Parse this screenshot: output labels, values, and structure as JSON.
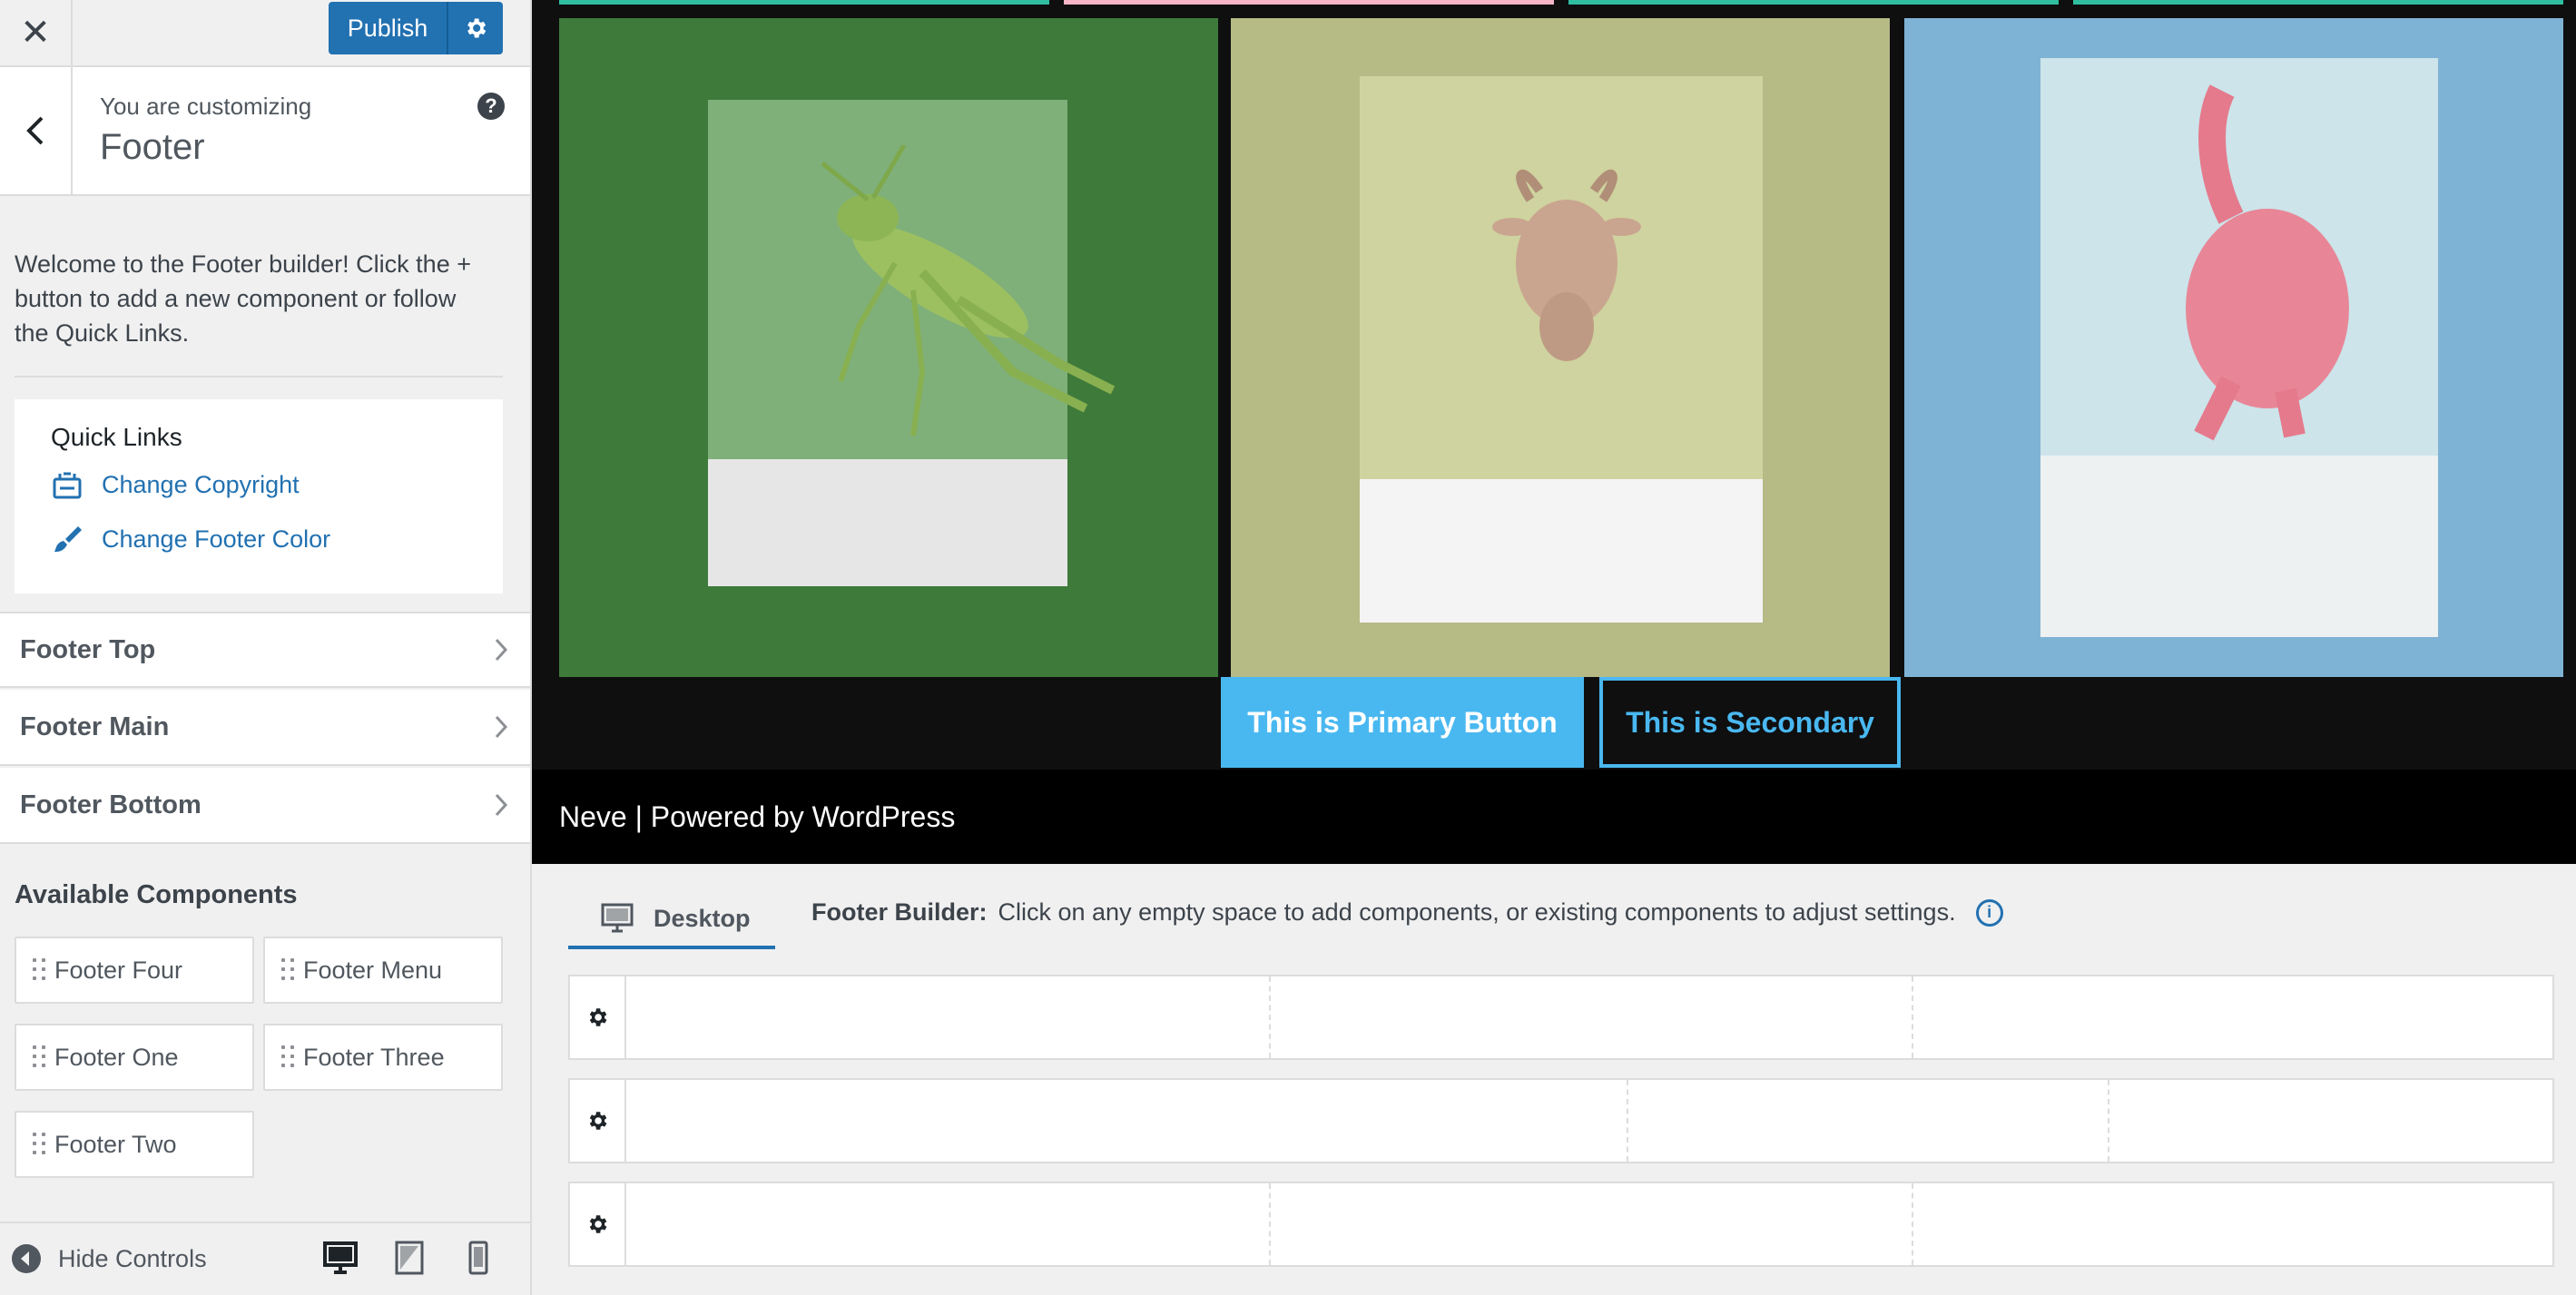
{
  "topbar": {
    "close_glyph": "✕",
    "publish_label": "Publish",
    "publish_settings_icon": "gear-icon"
  },
  "section": {
    "customizing_label": "You are customizing",
    "title": "Footer",
    "help_glyph": "?"
  },
  "welcome_text": "Welcome to the Footer builder! Click the + button to add a new component or follow the Quick Links.",
  "quick_links": {
    "title": "Quick Links",
    "items": [
      {
        "label": "Change Copyright",
        "icon": "copyright-icon"
      },
      {
        "label": "Change Footer Color",
        "icon": "paintbrush-icon"
      }
    ]
  },
  "accordion": [
    {
      "label": "Footer Top"
    },
    {
      "label": "Footer Main"
    },
    {
      "label": "Footer Bottom"
    }
  ],
  "available": {
    "title": "Available Components",
    "components": [
      {
        "label": "Footer Four"
      },
      {
        "label": "Footer Menu"
      },
      {
        "label": "Footer One"
      },
      {
        "label": "Footer Three"
      },
      {
        "label": "Footer Two"
      }
    ]
  },
  "bottombar": {
    "hide_controls_label": "Hide Controls",
    "devices": [
      "desktop-icon",
      "tablet-icon",
      "mobile-icon"
    ]
  },
  "preview": {
    "strip_colors": [
      "#2fbfa0",
      "#f6b5c8",
      "#2fbfa0",
      "#2fbfa0"
    ],
    "photos": [
      {
        "name": "grasshopper",
        "bg": "#3e7a3a",
        "card_top": "#7fb07a",
        "card_bottom": "#e6e6e6"
      },
      {
        "name": "goat",
        "bg": "#b6ba85",
        "card_top": "#cfd39f",
        "card_bottom": "#f4f4f4"
      },
      {
        "name": "pink-animal",
        "bg": "#7fb3d5",
        "card_top": "#cce4ea",
        "card_bottom": "#eef1f1"
      }
    ],
    "primary_button": "This is Primary Button",
    "secondary_button": "This is Secondary",
    "footer_text": "Neve | Powered by WordPress",
    "accent_color": "#4ab8f0"
  },
  "builder": {
    "tab_label": "Desktop",
    "note_bold": "Footer Builder:",
    "note_text": "Click on any empty space to add components, or existing components to adjust settings.",
    "rows": [
      "footer-top-row",
      "footer-main-row",
      "footer-bottom-row"
    ]
  }
}
